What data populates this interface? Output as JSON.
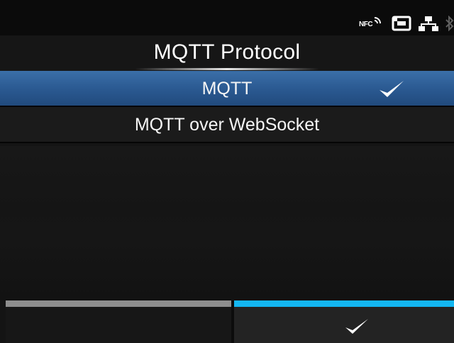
{
  "status_bar": {
    "nfc_label": "NFC",
    "icons": [
      "nfc-icon",
      "card-slot-icon",
      "network-icon",
      "bluetooth-icon"
    ]
  },
  "title": "MQTT Protocol",
  "options": [
    {
      "label": "MQTT",
      "selected": true
    },
    {
      "label": "MQTT over WebSocket",
      "selected": false
    }
  ],
  "softkeys": {
    "left": {
      "icon": "none",
      "bar_color": "#8e8e8e"
    },
    "right": {
      "icon": "check-icon",
      "bar_color": "#14b7f2"
    }
  },
  "colors": {
    "selected_row": "#2b5a92",
    "accent": "#14b7f2"
  }
}
